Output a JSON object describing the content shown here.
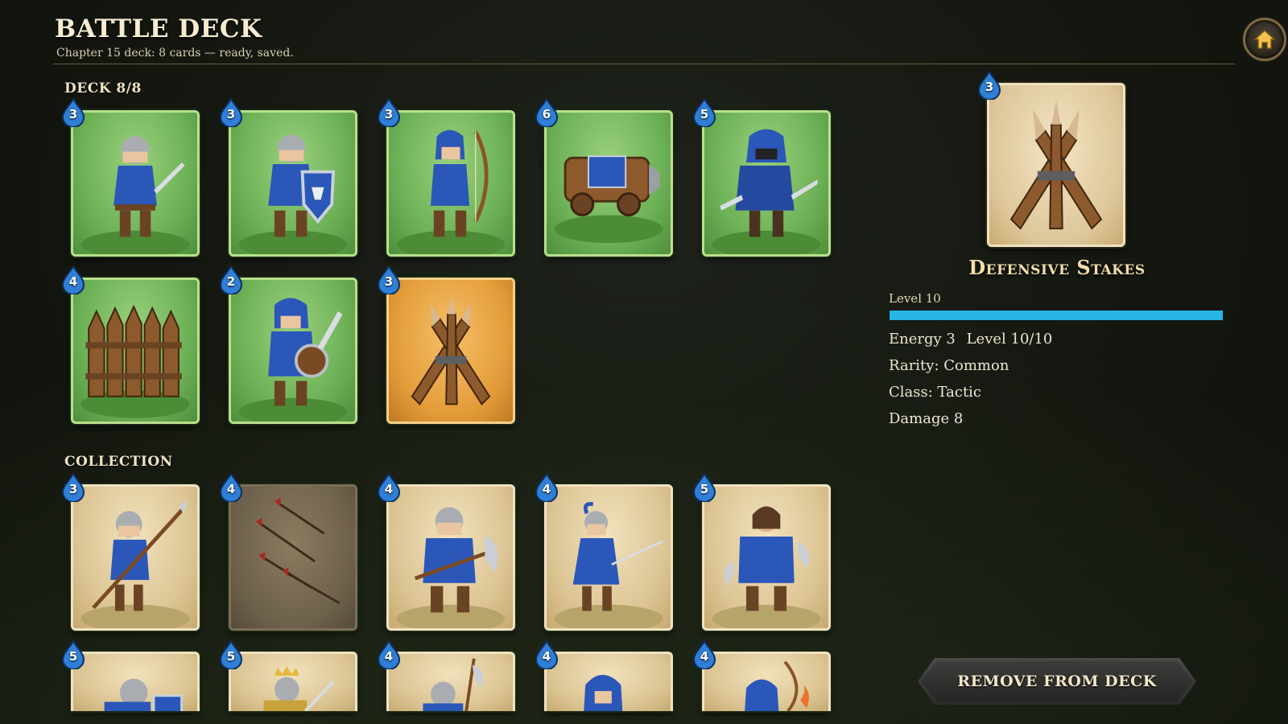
{
  "header": {
    "title": "BATTLE DECK",
    "subtitle": "Chapter 15 deck: 8 cards — ready, saved."
  },
  "deck": {
    "label": "DECK 8/8",
    "cards": [
      {
        "name": "swordsman",
        "cost": "3"
      },
      {
        "name": "shield-knight",
        "cost": "3"
      },
      {
        "name": "archer",
        "cost": "3"
      },
      {
        "name": "cannon",
        "cost": "6"
      },
      {
        "name": "rogue",
        "cost": "5"
      },
      {
        "name": "palisade",
        "cost": "4"
      },
      {
        "name": "militia",
        "cost": "2"
      },
      {
        "name": "defensive-stakes",
        "cost": "3"
      }
    ]
  },
  "collection": {
    "label": "COLLECTION",
    "cards": [
      {
        "name": "spearman",
        "cost": "3"
      },
      {
        "name": "arrow-volley",
        "cost": "4"
      },
      {
        "name": "axeman",
        "cost": "4"
      },
      {
        "name": "duelist",
        "cost": "4"
      },
      {
        "name": "berserker",
        "cost": "5"
      },
      {
        "name": "shield-bearer",
        "cost": "5"
      },
      {
        "name": "king-knight",
        "cost": "5"
      },
      {
        "name": "halberdier",
        "cost": "4"
      },
      {
        "name": "hooded-scout",
        "cost": "4"
      },
      {
        "name": "fire-archer",
        "cost": "4"
      }
    ]
  },
  "detail": {
    "cost": "3",
    "name": "Defensive Stakes",
    "level_label": "Level 10",
    "level_progress": 1.0,
    "stats": {
      "energy": "Energy 3",
      "level": "Level 10/10",
      "rarity": "Rarity: Common",
      "class": "Class: Tactic",
      "damage": "Damage 8"
    },
    "remove_label": "REMOVE FROM DECK"
  },
  "colors": {
    "accent": "#28b5e4",
    "deck_card": "#6eb257",
    "selected_card": "#e49c3a",
    "collection_card": "#dcc594"
  }
}
